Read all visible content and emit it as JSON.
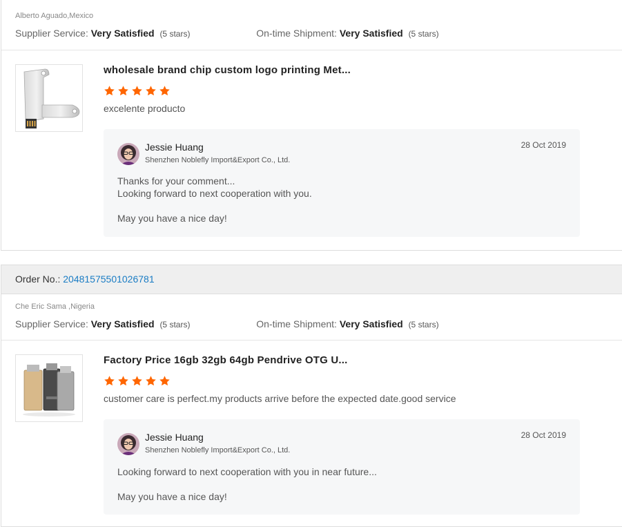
{
  "reviews": [
    {
      "buyer": "Alberto Aguado,Mexico",
      "supplier_service_label": "Supplier Service:",
      "supplier_service_value": "Very Satisfied",
      "supplier_service_stars": "(5 stars)",
      "shipment_label": "On-time Shipment:",
      "shipment_value": "Very Satisfied",
      "shipment_stars": "(5 stars)",
      "product_title": "wholesale brand chip custom logo printing Met...",
      "product_image": "key-shaped-usb-icon",
      "rating": 5,
      "comment": "excelente producto",
      "reply": {
        "name": "Jessie Huang",
        "company": "Shenzhen Noblefly Import&Export Co., Ltd.",
        "date": "28 Oct 2019",
        "lines": [
          "Thanks for your comment...",
          "Looking forward to next cooperation with you.",
          "",
          "May you have a nice day!"
        ]
      }
    },
    {
      "order_label": "Order No.:",
      "order_number": "20481575501026781",
      "buyer": "Che Eric Sama ,Nigeria",
      "supplier_service_label": "Supplier Service:",
      "supplier_service_value": "Very Satisfied",
      "supplier_service_stars": "(5 stars)",
      "shipment_label": "On-time Shipment:",
      "shipment_value": "Very Satisfied",
      "shipment_stars": "(5 stars)",
      "product_title": "Factory Price 16gb 32gb 64gb Pendrive OTG U...",
      "product_image": "otg-usb-drives-icon",
      "rating": 5,
      "comment": "customer care is perfect.my products arrive before the expected date.good service",
      "reply": {
        "name": "Jessie Huang",
        "company": "Shenzhen Noblefly Import&Export Co., Ltd.",
        "date": "28 Oct 2019",
        "lines": [
          "Looking forward to next cooperation with you in near future...",
          "",
          "May you have a nice day!"
        ]
      }
    }
  ],
  "colors": {
    "star": "#ff6600",
    "link": "#1a7cc4",
    "order_bar_bg": "#efefef",
    "reply_bg": "#f6f7f8"
  }
}
